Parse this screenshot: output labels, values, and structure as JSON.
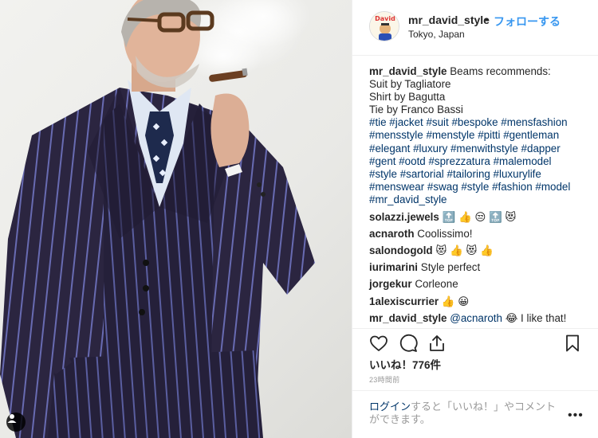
{
  "header": {
    "username": "mr_david_style",
    "separator": "•",
    "follow_label": "フォローする",
    "location": "Tokyo, Japan"
  },
  "caption": {
    "username": "mr_david_style",
    "lines": [
      "Beams recommends:",
      "Suit by Tagliatore",
      "Shirt by Bagutta",
      "Tie by Franco Bassi"
    ],
    "hashtag_lines": [
      "#tie #jacket #suit #bespoke #mensfashion",
      "#mensstyle #menstyle #pitti #gentleman",
      "#elegant #luxury #menwithstyle #dapper",
      "#gent #ootd #sprezzatura #malemodel",
      "#style #sartorial #tailoring #luxurylife",
      "#menswear #swag #style #fashion #model",
      "#mr_david_style"
    ]
  },
  "comments": [
    {
      "user": "solazzi.jewels",
      "text": "🔝 👍 😒 🔝 😻"
    },
    {
      "user": "acnaroth",
      "text": "Coolissimo!"
    },
    {
      "user": "salondogold",
      "text": "😻 👍 😻 👍"
    },
    {
      "user": "iurimarini",
      "text": "Style perfect"
    },
    {
      "user": "jorgekur",
      "text": "Corleone"
    },
    {
      "user": "1alexiscurrier",
      "text": "👍 😀"
    },
    {
      "user": "mr_david_style",
      "mention": "@acnaroth",
      "text": " 😂  I like that!"
    }
  ],
  "likes": "いいね！776件",
  "timestamp": "23時間前",
  "login": {
    "link": "ログイン",
    "text": "すると「いいね！」やコメントができます。"
  },
  "more_label": "•••",
  "icons": {
    "like": "heart-icon",
    "comment": "comment-icon",
    "share": "share-icon",
    "save": "bookmark-icon",
    "user_tag": "user-tag-icon"
  },
  "colors": {
    "link": "#003569",
    "follow": "#3897f0",
    "suit": "#2b2540",
    "stripe": "#7c83d8"
  }
}
